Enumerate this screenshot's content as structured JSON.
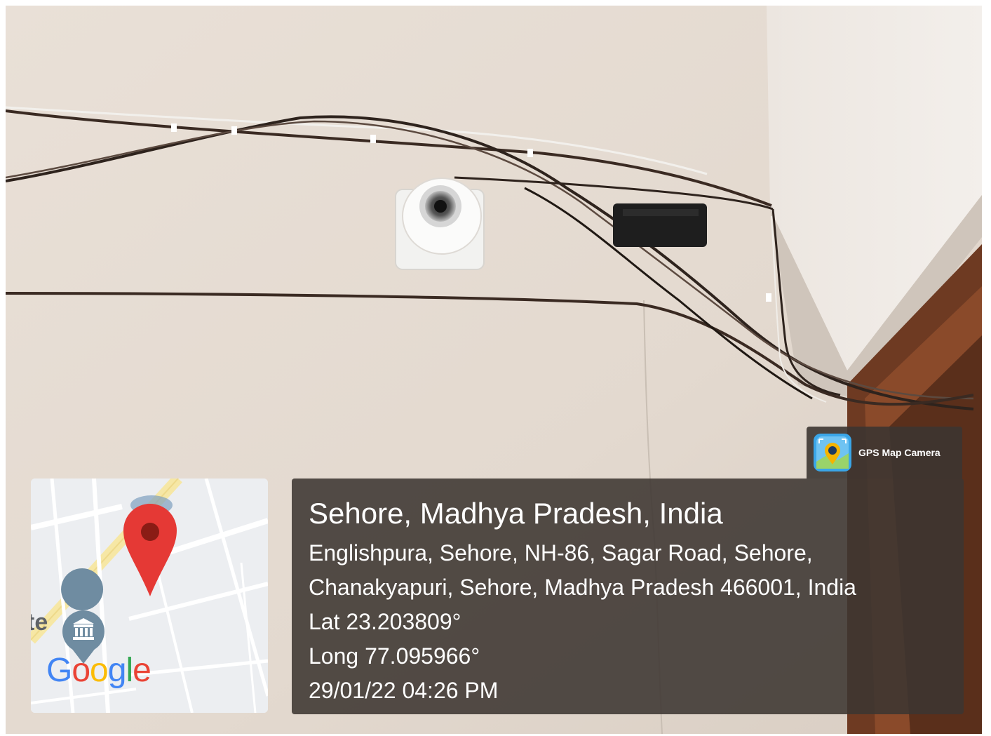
{
  "watermark": {
    "app_name": "GPS Map Camera",
    "app_icon": "gps-map-camera-icon"
  },
  "map": {
    "partial_place_label": "te",
    "poi_icon": "museum-icon",
    "pin_icon": "map-pin-icon",
    "logo_letters": [
      "G",
      "o",
      "o",
      "g",
      "l",
      "e"
    ],
    "logo_colors": [
      "#4285F4",
      "#EA4335",
      "#FBBC05",
      "#4285F4",
      "#34A853",
      "#EA4335"
    ]
  },
  "location": {
    "title": "Sehore, Madhya Pradesh, India",
    "address_line1": "Englishpura, Sehore, NH-86, Sagar Road, Sehore,",
    "address_line2": "Chanakyapuri, Sehore, Madhya Pradesh 466001, India",
    "latitude": "Lat 23.203809°",
    "longitude": "Long 77.095966°",
    "datetime": "29/01/22 04:26 PM"
  },
  "colors": {
    "wall": "#e6ddd4",
    "panel": "#3c3531",
    "pin": "#e53935",
    "door_frame": "#7a3b1e"
  }
}
